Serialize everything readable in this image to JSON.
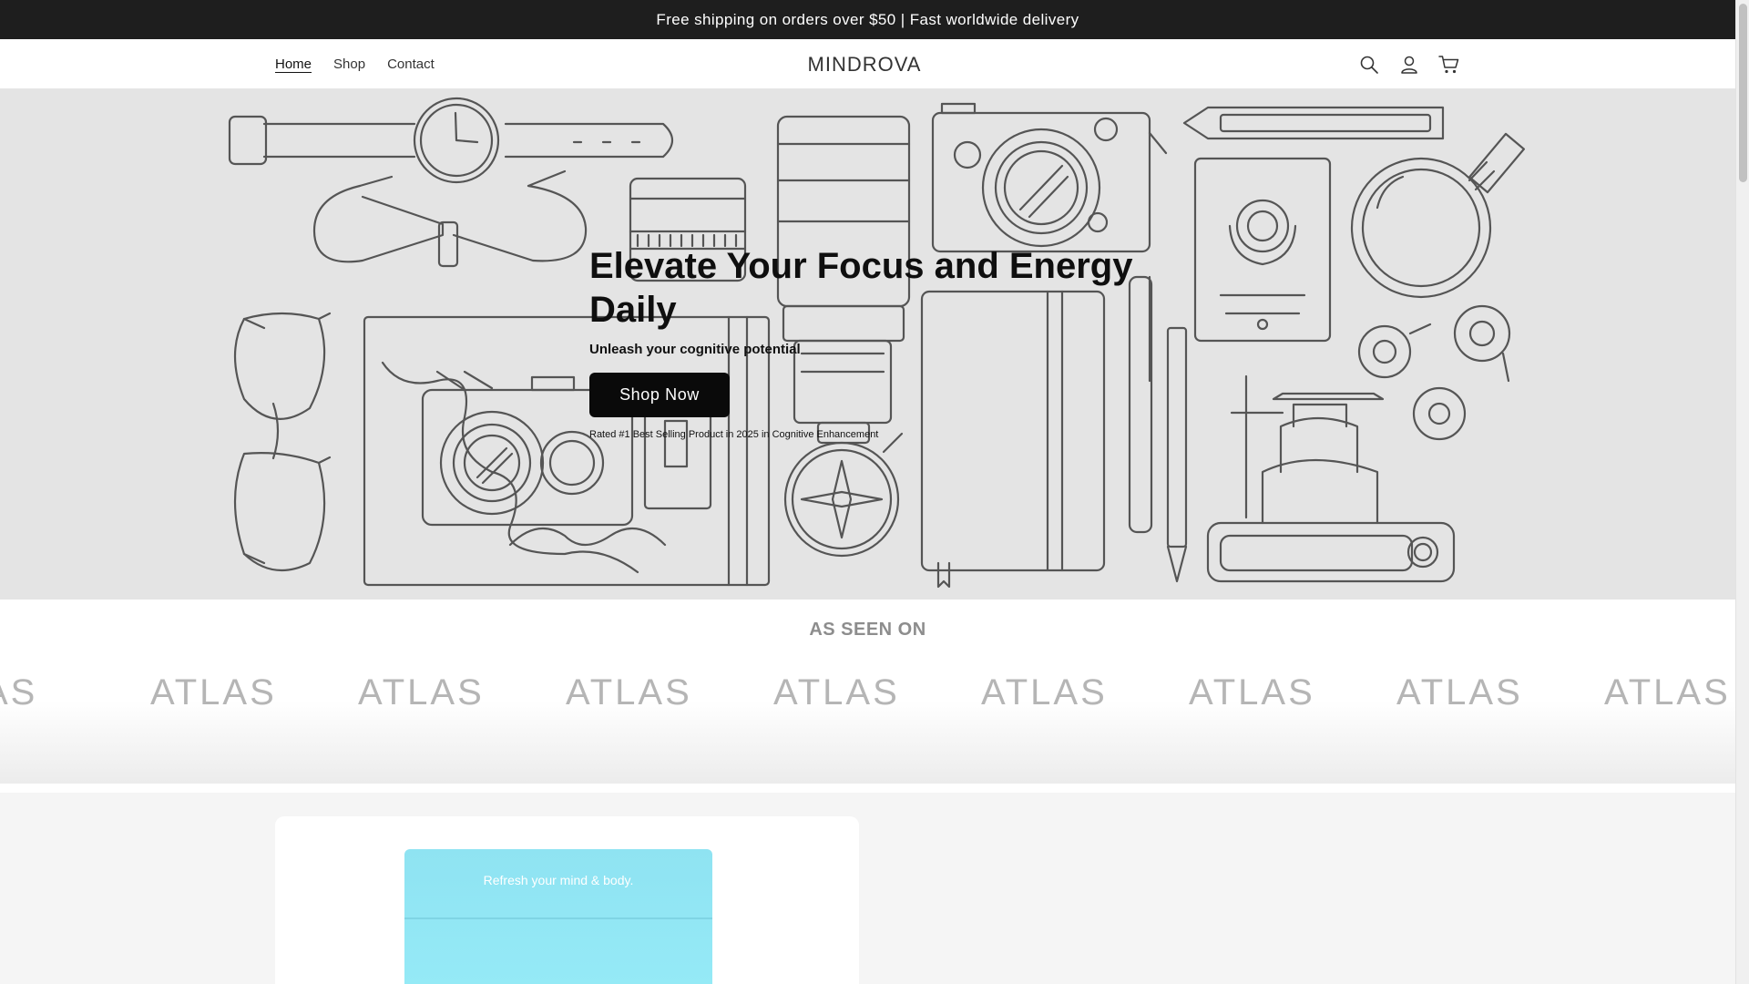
{
  "announcement": {
    "text": "Free shipping on orders over $50 | Fast worldwide delivery"
  },
  "header": {
    "nav": [
      {
        "label": "Home",
        "active": true
      },
      {
        "label": "Shop",
        "active": false
      },
      {
        "label": "Contact",
        "active": false
      }
    ],
    "logo": "MINDROVA",
    "icons": [
      "search-icon",
      "account-icon",
      "cart-icon"
    ]
  },
  "hero": {
    "title": "Elevate Your Focus and Energy Daily",
    "subtitle": "Unleash your cognitive potential",
    "button_label": "Shop Now",
    "rated_text": "Rated #1 Best Selling Product in 2025 in Cognitive Enhancement"
  },
  "seen_on": {
    "title": "AS SEEN ON",
    "logos": [
      "AS",
      "ATLAS",
      "ATLAS",
      "ATLAS",
      "ATLAS",
      "ATLAS",
      "ATLAS",
      "ATLAS",
      "ATLAS"
    ]
  },
  "product": {
    "pouch_text": "Refresh your mind & body."
  },
  "colors": {
    "announcement_bg": "#1e1e1e",
    "hero_bg": "#e4e4e4",
    "button_bg": "#0a0a0a",
    "pouch": "#8fe3f2"
  }
}
